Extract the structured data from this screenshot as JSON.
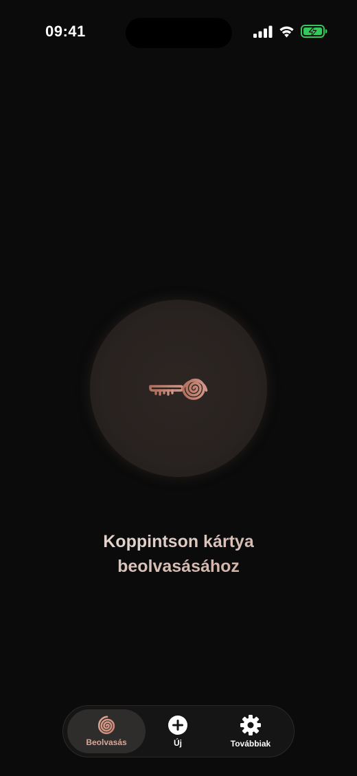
{
  "status_bar": {
    "time": "09:41",
    "icons": [
      "cellular-signal-icon",
      "wifi-icon",
      "battery-charging-icon"
    ],
    "battery_color": "#34c759"
  },
  "reader": {
    "icon": "key-spiral-icon",
    "prompt_line1": "Koppintson kártya",
    "prompt_line2": "beolvasásához",
    "accent_color": "#c98f7c"
  },
  "tab_bar": {
    "active": "scan",
    "tabs": [
      {
        "id": "scan",
        "label": "Beolvasás",
        "icon": "spiral-icon"
      },
      {
        "id": "new",
        "label": "Új",
        "icon": "plus-circle-icon"
      },
      {
        "id": "more",
        "label": "Továbbiak",
        "icon": "gear-icon"
      }
    ]
  }
}
